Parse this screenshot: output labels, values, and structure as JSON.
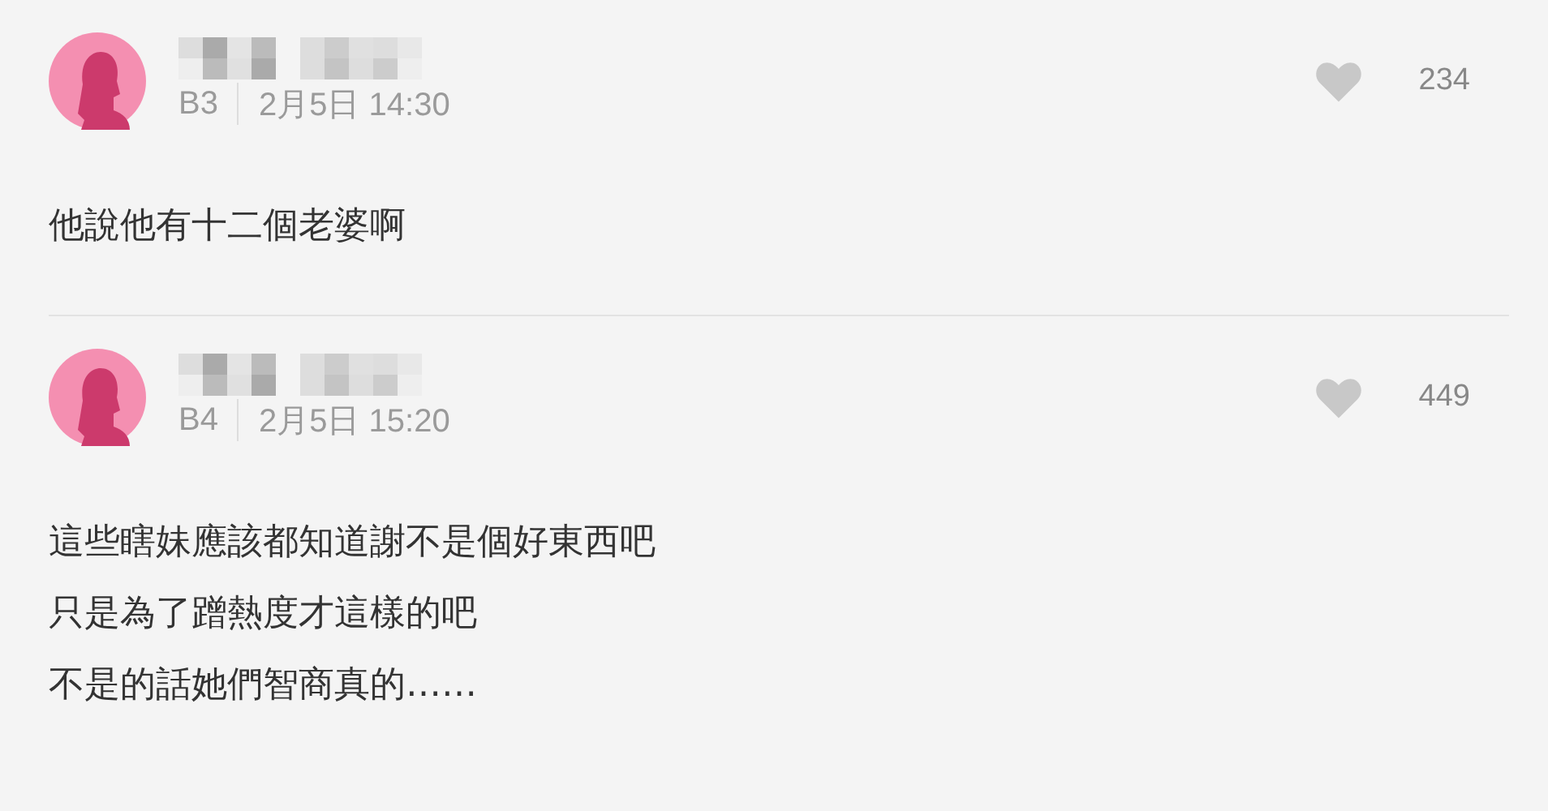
{
  "comments": [
    {
      "name_hidden": true,
      "floor": "B3",
      "time": "2月5日 14:30",
      "likes": "234",
      "liked": false,
      "lines": [
        "他說他有十二個老婆啊"
      ]
    },
    {
      "name_hidden": true,
      "floor": "B4",
      "time": "2月5日 15:20",
      "likes": "449",
      "liked": false,
      "lines": [
        "這些瞎妹應該都知道謝不是個好東西吧",
        "只是為了蹭熱度才這樣的吧",
        "不是的話她們智商真的……"
      ]
    }
  ]
}
